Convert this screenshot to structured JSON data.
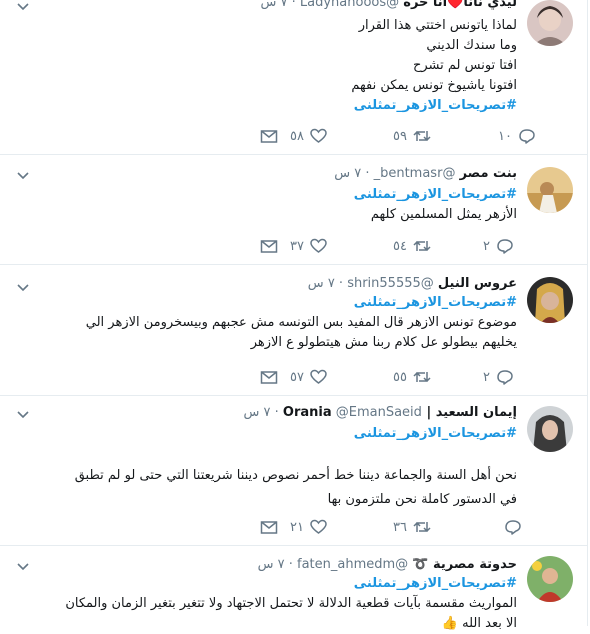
{
  "tweets": [
    {
      "name": "ليدي نانا♥️انا حره",
      "handle": "@Ladynanooos",
      "time": "٧ س",
      "lines": [
        "لماذا ياتونس اختتي هذا القرار",
        "وما سندك الديني",
        "افتا تونس لم تشرح",
        "افتونا ياشيوخ تونس يمكن نفهم"
      ],
      "hashtag": "#تصريحات_الازهر_تمثلنى",
      "replies": "١٠",
      "retweets": "٥٩",
      "likes": "٥٨"
    },
    {
      "name": "بنت مصر",
      "handle": "@bentmasr_",
      "time": "٧ س",
      "hashtag": "#تصريحات_الازهر_تمثلنى",
      "lines": [
        "الأزهر يمثل المسلمين كلهم"
      ],
      "replies": "٢",
      "retweets": "٥٤",
      "likes": "٣٧"
    },
    {
      "name": "عروس النيل",
      "handle": "@shrin55555",
      "time": "٧ س",
      "hashtag": "#تصريحات_الازهر_تمثلنى",
      "lines": [
        "موضوع تونس الازهر قال المفيد بس التونسه مش عجبهم وبيسخرومن الازهر الي",
        "يخليهم بيطولو عل كلام ربنا مش هيتطولو ع الازهر"
      ],
      "replies": "٢",
      "retweets": "٥٥",
      "likes": "٥٧"
    },
    {
      "name": "إيمان السعيد | Orania",
      "handle": "@EmanSaeid",
      "time": "٧ س",
      "hashtag": "#تصريحات_الازهر_تمثلنى",
      "lines": [
        "نحن أهل السنة والجماعة ديننا خط أحمر نصوص ديننا شريعتنا التي حتى لو لم تطبق",
        "في الدستور كاملة نحن ملتزمون بها"
      ],
      "replies": "",
      "retweets": "٣٦",
      "likes": "٢١"
    },
    {
      "name": "حدوتة مصرية ➰",
      "handle": "@faten_ahmedm",
      "time": "٧ س",
      "hashtag": "#تصريحات_الازهر_تمثلنى",
      "lines": [
        "المواريث مقسمة بآيات قطعية الدلالة لا تحتمل الاجتهاد ولا تتغير بتغير الزمان والمكان",
        "الا بعد الله 👍"
      ],
      "replies": "",
      "retweets": "",
      "likes": ""
    }
  ],
  "icons": {
    "reply": "reply-icon",
    "retweet": "retweet-icon",
    "like": "heart-icon",
    "dm": "envelope-icon",
    "caret": "chevron-down-icon"
  },
  "colors": {
    "hashtag": "#1b95e0",
    "muted": "#657786",
    "border": "#e6ecf0"
  }
}
